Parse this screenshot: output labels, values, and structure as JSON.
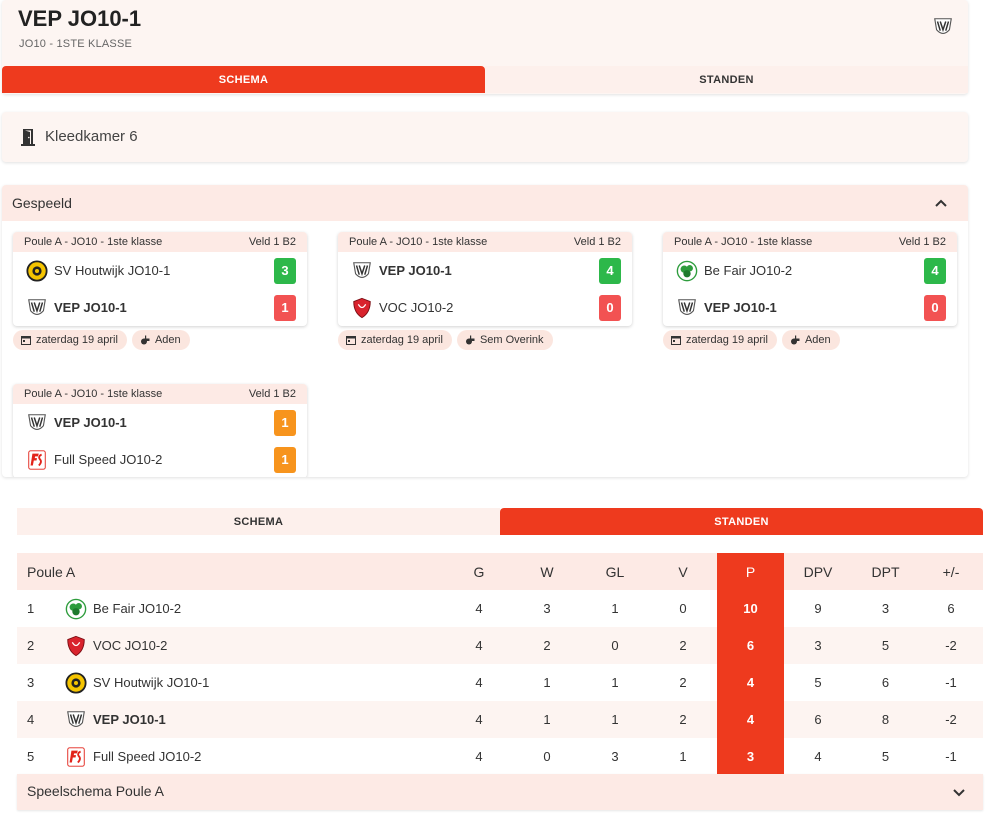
{
  "header": {
    "title": "VEP JO10-1",
    "subtitle": "JO10 - 1STE KLASSE",
    "logo_icon": "vep-crest-icon"
  },
  "tabs": {
    "schema": "SCHEMA",
    "standen": "STANDEN"
  },
  "room": {
    "label": "Kleedkamer 6",
    "icon": "door-icon"
  },
  "played": {
    "title": "Gespeeld",
    "matches": [
      {
        "poule": "Poule A - JO10 - 1ste klasse",
        "field": "Veld 1 B2",
        "home": "SV Houtwijk JO10-1",
        "home_score": "3",
        "away": "VEP JO10-1",
        "away_score": "1",
        "date": "zaterdag 19 april",
        "referee": "Aden"
      },
      {
        "poule": "Poule A - JO10 - 1ste klasse",
        "field": "Veld 1 B2",
        "home": "VEP JO10-1",
        "home_score": "4",
        "away": "VOC JO10-2",
        "away_score": "0",
        "date": "zaterdag 19 april",
        "referee": "Sem Overink"
      },
      {
        "poule": "Poule A - JO10 - 1ste klasse",
        "field": "Veld 1 B2",
        "home": "Be Fair JO10-2",
        "home_score": "4",
        "away": "VEP JO10-1",
        "away_score": "0",
        "date": "zaterdag 19 april",
        "referee": "Aden"
      },
      {
        "poule": "Poule A - JO10 - 1ste klasse",
        "field": "Veld 1 B2",
        "home": "VEP JO10-1",
        "home_score": "1",
        "away": "Full Speed JO10-2",
        "away_score": "1"
      }
    ]
  },
  "standings": {
    "title": "Poule A",
    "columns": [
      "G",
      "W",
      "GL",
      "V",
      "P",
      "DPV",
      "DPT",
      "+/-"
    ],
    "rows": [
      {
        "pos": "1",
        "team": "Be Fair JO10-2",
        "G": "4",
        "W": "3",
        "GL": "1",
        "V": "0",
        "P": "10",
        "DPV": "9",
        "DPT": "3",
        "diff": "6"
      },
      {
        "pos": "2",
        "team": "VOC JO10-2",
        "G": "4",
        "W": "2",
        "GL": "0",
        "V": "2",
        "P": "6",
        "DPV": "3",
        "DPT": "5",
        "diff": "-2"
      },
      {
        "pos": "3",
        "team": "SV Houtwijk JO10-1",
        "G": "4",
        "W": "1",
        "GL": "1",
        "V": "2",
        "P": "4",
        "DPV": "5",
        "DPT": "6",
        "diff": "-1"
      },
      {
        "pos": "4",
        "team": "VEP JO10-1",
        "G": "4",
        "W": "1",
        "GL": "1",
        "V": "2",
        "P": "4",
        "DPV": "6",
        "DPT": "8",
        "diff": "-2"
      },
      {
        "pos": "5",
        "team": "Full Speed JO10-2",
        "G": "4",
        "W": "0",
        "GL": "3",
        "V": "1",
        "P": "3",
        "DPV": "4",
        "DPT": "5",
        "diff": "-1"
      }
    ]
  },
  "schedule": {
    "title": "Speelschema Poule A"
  },
  "colors": {
    "accent": "#ee3a1e",
    "win": "#2db84a",
    "loss": "#f25252",
    "draw": "#f7941d",
    "header_bg": "#fdeae5"
  }
}
